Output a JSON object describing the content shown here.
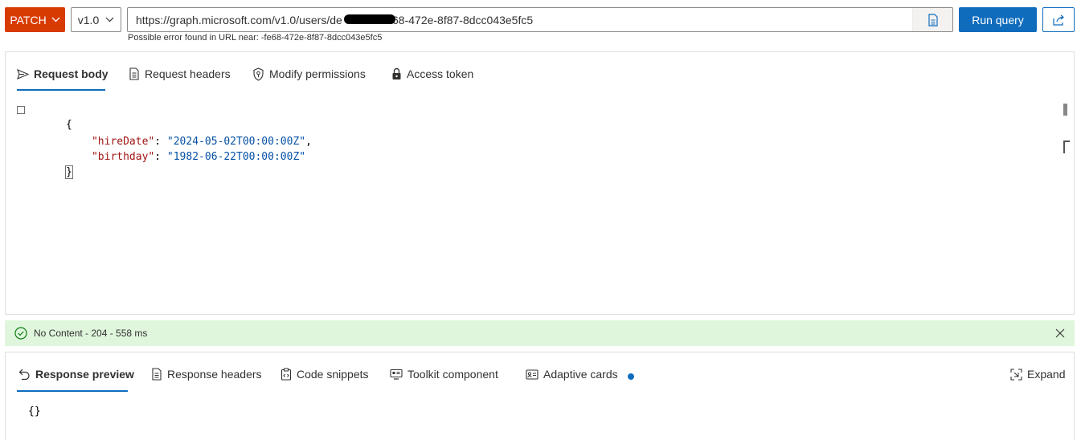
{
  "toolbar": {
    "method": "PATCH",
    "version": "v1.0",
    "url_value": "https://graph.microsoft.com/v1.0/users/de                68-472e-8f87-8dcc043e5fc5",
    "run_label": "Run query",
    "url_error": "Possible error found in URL near: -fe68-472e-8f87-8dcc043e5fc5"
  },
  "request_tabs": [
    {
      "label": "Request body",
      "icon": "send-icon",
      "active": true
    },
    {
      "label": "Request headers",
      "icon": "document-icon",
      "active": false
    },
    {
      "label": "Modify permissions",
      "icon": "shield-key-icon",
      "active": false
    },
    {
      "label": "Access token",
      "icon": "lock-icon",
      "active": false
    }
  ],
  "request_body": {
    "open_brace": "{",
    "close_brace": "}",
    "fields": [
      {
        "key": "\"hireDate\"",
        "value": "\"2024-05-02T00:00:00Z\"",
        "trailing": ","
      },
      {
        "key": "\"birthday\"",
        "value": "\"1982-06-22T00:00:00Z\"",
        "trailing": ""
      }
    ]
  },
  "status": {
    "text": "No Content - 204 - 558 ms",
    "color": "#dff6dd",
    "icon": "check-circle-icon"
  },
  "response_tabs": [
    {
      "label": "Response preview",
      "icon": "undo-arrow-icon",
      "active": true
    },
    {
      "label": "Response headers",
      "icon": "document-icon",
      "active": false
    },
    {
      "label": "Code snippets",
      "icon": "clipboard-code-icon",
      "active": false
    },
    {
      "label": "Toolkit component",
      "icon": "toolkit-icon",
      "active": false
    },
    {
      "label": "Adaptive cards",
      "icon": "card-icon",
      "active": false
    }
  ],
  "expand_label": "Expand",
  "response_body": "{}",
  "colors": {
    "method": "#d83b01",
    "accent": "#0f6cbd",
    "json_key": "#a31515",
    "json_string": "#0451a5"
  }
}
